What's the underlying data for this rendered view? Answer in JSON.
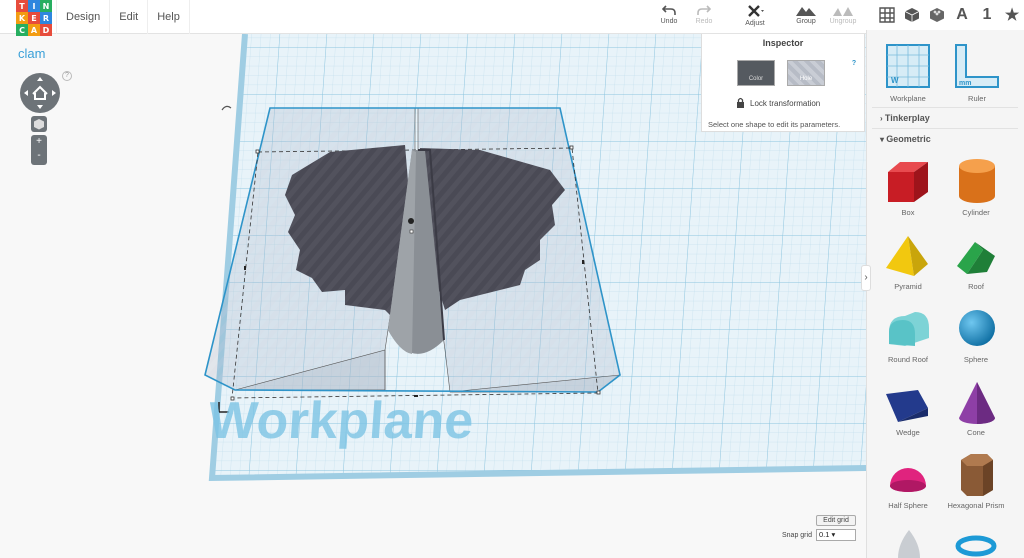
{
  "logo": {
    "letters": [
      "T",
      "I",
      "N",
      "K",
      "E",
      "R",
      "C",
      "A",
      "D"
    ],
    "colors": [
      "#e74c3c",
      "#2e86de",
      "#27ae60",
      "#f39c12",
      "#e74c3c",
      "#2e86de",
      "#27ae60",
      "#f39c12",
      "#e74c3c"
    ]
  },
  "menu": {
    "items": [
      "Design",
      "Edit",
      "Help"
    ]
  },
  "toolbar": {
    "undo": "Undo",
    "redo": "Redo",
    "adjust": "Adjust",
    "group": "Group",
    "ungroup": "Ungroup"
  },
  "project": {
    "name": "clam"
  },
  "view_icons": [
    "grid-view-icon",
    "cube-view-icon",
    "brick-view-icon",
    "text-icon",
    "number-icon",
    "star-icon"
  ],
  "view_labels": {
    "text": "A",
    "number": "1",
    "star": "★"
  },
  "inspector": {
    "title": "Inspector",
    "help": "?",
    "color_label": "Color",
    "hole_label": "Hole",
    "lock_label": "Lock transformation",
    "message": "Select one shape to edit its parameters."
  },
  "workplane_text": "Workplane",
  "sidebar": {
    "top_items": [
      {
        "label": "Workplane"
      },
      {
        "label": "Ruler"
      }
    ],
    "sections": [
      {
        "label": "Tinkerplay"
      },
      {
        "label": "Geometric"
      }
    ],
    "shapes": [
      {
        "label": "Box",
        "color": "#d7232b"
      },
      {
        "label": "Cylinder",
        "color": "#e8821b"
      },
      {
        "label": "Pyramid",
        "color": "#f2c80f"
      },
      {
        "label": "Roof",
        "color": "#2aa44a"
      },
      {
        "label": "Round Roof",
        "color": "#59c3c7"
      },
      {
        "label": "Sphere",
        "color": "#1d9ad6"
      },
      {
        "label": "Wedge",
        "color": "#233a8c"
      },
      {
        "label": "Cone",
        "color": "#8e3fa6"
      },
      {
        "label": "Half Sphere",
        "color": "#e0237e"
      },
      {
        "label": "Hexagonal Prism",
        "color": "#8a5a36"
      }
    ]
  },
  "grid": {
    "edit_label": "Edit grid",
    "snap_label": "Snap grid",
    "snap_value": "0.1 ▾"
  }
}
